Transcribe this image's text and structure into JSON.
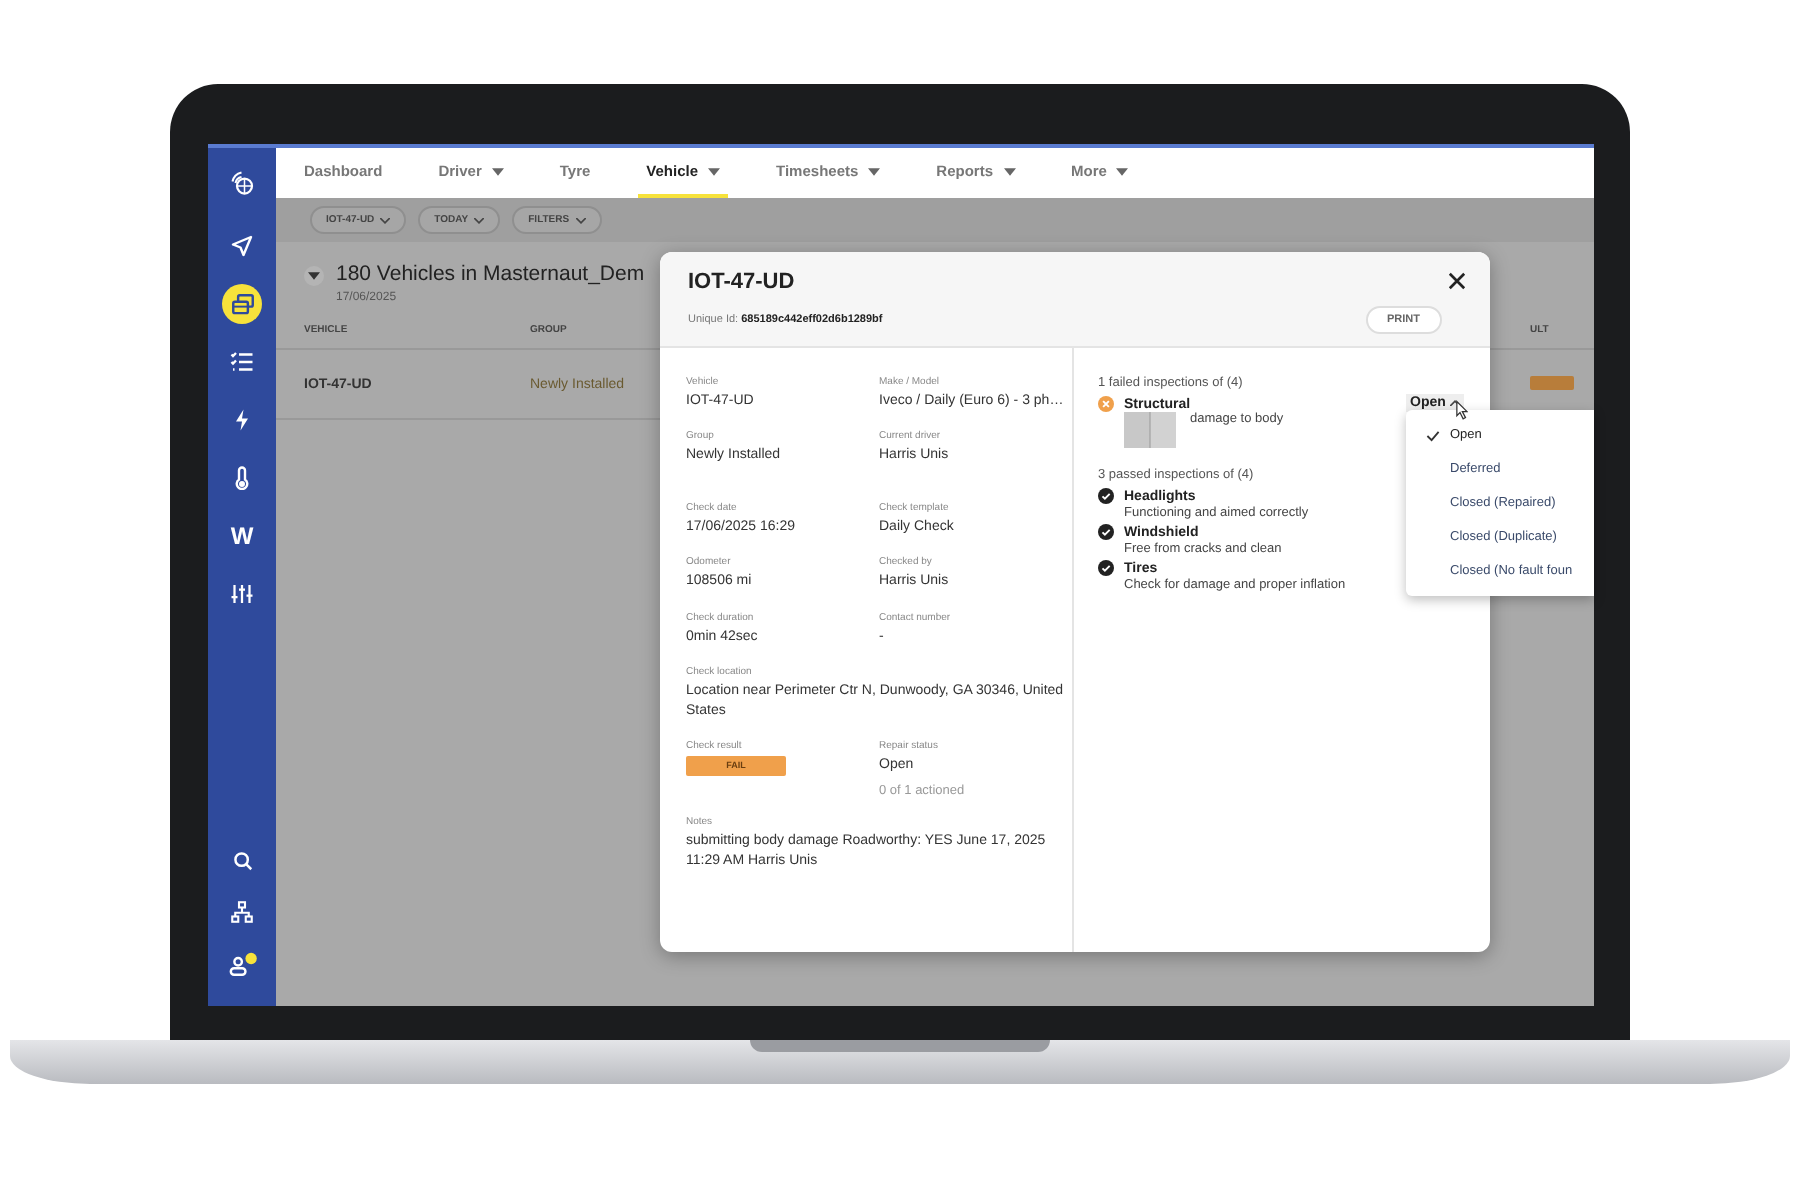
{
  "sidebar": {
    "items": [
      {
        "selected": false
      },
      {
        "selected": true
      },
      {
        "selected": false
      },
      {
        "selected": false
      },
      {
        "selected": false
      },
      {
        "selected": false,
        "label": "W"
      },
      {
        "selected": false
      }
    ]
  },
  "nav": {
    "tabs": [
      {
        "label": "Dashboard",
        "dropdown": false,
        "selected": false
      },
      {
        "label": "Driver",
        "dropdown": true,
        "selected": false
      },
      {
        "label": "Tyre",
        "dropdown": false,
        "selected": false
      },
      {
        "label": "Vehicle",
        "dropdown": true,
        "selected": true
      },
      {
        "label": "Timesheets",
        "dropdown": true,
        "selected": false
      },
      {
        "label": "Reports",
        "dropdown": true,
        "selected": false
      },
      {
        "label": "More",
        "dropdown": true,
        "selected": false
      }
    ]
  },
  "filters": [
    "IOT-47-UD",
    "TODAY",
    "FILTERS"
  ],
  "page": {
    "title": "180 Vehicles in Masternaut_Dem",
    "date": "17/06/2025",
    "table": {
      "columns": [
        "VEHICLE",
        "GROUP",
        "ULT"
      ],
      "rows": [
        {
          "vehicle": "IOT-47-UD",
          "group": "Newly Installed"
        }
      ]
    }
  },
  "modal": {
    "title": "IOT-47-UD",
    "unique_id": "Unique Id: **685189c442eff02d6b1289bf**",
    "print": "PRINT",
    "field_rows": [
      [
        {
          "label": "Vehicle",
          "value": "IOT-47-UD"
        },
        {
          "label": "Make / Model",
          "value": "Iveco / Daily (Euro 6) - 3 ph…"
        }
      ],
      [
        {
          "label": "Group",
          "value": "Newly Installed"
        },
        {
          "label": "Current driver",
          "value": "Harris Unis"
        }
      ],
      [
        {
          "label": "Check date",
          "value": "17/06/2025 16:29"
        },
        {
          "label": "Check template",
          "value": "Daily Check"
        }
      ],
      [
        {
          "label": "Odometer",
          "value": "108506 mi"
        },
        {
          "label": "Checked by",
          "value": "Harris Unis"
        }
      ],
      [
        {
          "label": "Check duration",
          "value": "0min 42sec"
        },
        {
          "label": "Contact number",
          "value": "-"
        }
      ],
      [
        {
          "label": "Check location",
          "value": "Location near Perimeter Ctr N, Dunwoody, GA 30346, United States"
        }
      ],
      [
        {
          "label": "Check result",
          "value": "FAIL",
          "kind": "badge"
        },
        {
          "label": "Repair status",
          "value": "Open",
          "sub": "0 of 1 actioned"
        }
      ],
      [
        {
          "label": "Notes",
          "value": "submitting body damage Roadworthy: YES June 17, 2025 11:29 AM Harris Unis"
        }
      ]
    ],
    "failed_heading": "1 failed inspections of (4)",
    "failed": [
      {
        "name": "Structural",
        "note": "damage to body",
        "status": "Open"
      }
    ],
    "passed_heading": "3 passed inspections of (4)",
    "passed": [
      {
        "name": "Headlights",
        "note": "Functioning and aimed correctly"
      },
      {
        "name": "Windshield",
        "note": "Free from cracks and clean"
      },
      {
        "name": "Tires",
        "note": "Check for damage and proper inflation"
      }
    ]
  },
  "status_menu": [
    {
      "label": "Open",
      "selected": true
    },
    {
      "label": "Deferred",
      "selected": false
    },
    {
      "label": "Closed (Repaired)",
      "selected": false
    },
    {
      "label": "Closed (Duplicate)",
      "selected": false
    },
    {
      "label": "Closed (No fault foun",
      "selected": false
    }
  ]
}
